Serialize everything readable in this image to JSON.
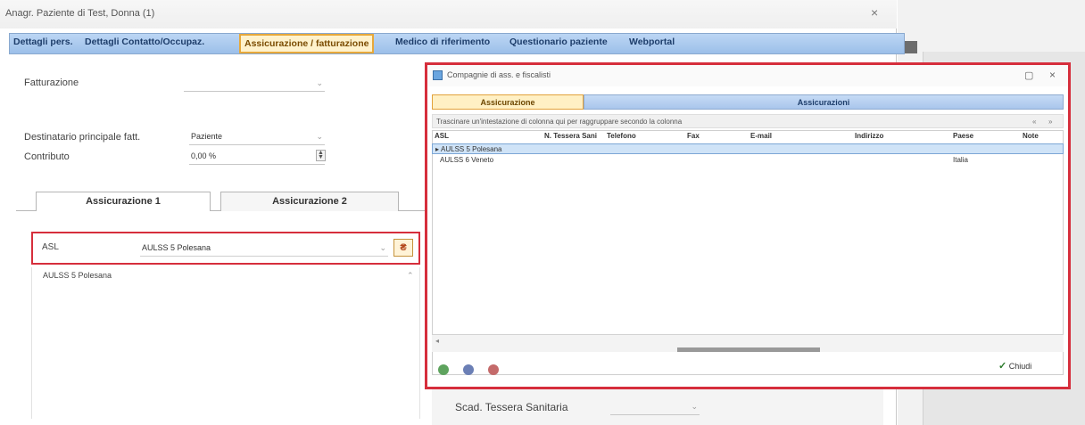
{
  "main_window": {
    "title": "Anagr. Paziente di Test, Donna (1)",
    "close": "×",
    "tabs": [
      "Dettagli pers.",
      "Dettagli Contatto/Occupaz.",
      "Assicurazione / fatturazione",
      "Medico di riferimento",
      "Questionario paziente",
      "Webportal"
    ],
    "active_tab_index": 2
  },
  "billing": {
    "fatturazione_label": "Fatturazione",
    "fatturazione_value": "",
    "destinatario_label": "Destinatario principale fatt.",
    "destinatario_value": "Paziente",
    "contributo_label": "Contributo",
    "contributo_value": "0,00 %"
  },
  "insurance_tabs": [
    "Assicurazione 1",
    "Assicurazione 2"
  ],
  "asl": {
    "label": "ASL",
    "value": "AULSS 5 Polesana",
    "list_item": "AULSS 5 Polesana",
    "button_icon": "asl-lookup-icon"
  },
  "lower": {
    "scad_label": "Scad. Tessera Sanitaria",
    "scad_value": ""
  },
  "dialog": {
    "title": "Compagnie di ass. e fiscalisti",
    "tabs": [
      "Assicurazione",
      "Assicurazioni"
    ],
    "hint": "Trascinare un'intestazione di colonna qui per raggruppare secondo la colonna",
    "columns": [
      "ASL",
      "N. Tessera Sani",
      "Telefono",
      "Fax",
      "E-mail",
      "Indirizzo",
      "Paese",
      "Note"
    ],
    "rows": [
      {
        "asl": "AULSS 5 Polesana",
        "paese": "",
        "selected": true
      },
      {
        "asl": "AULSS 6 Veneto",
        "paese": "Italia",
        "selected": false
      }
    ],
    "ok_label": "Chiudi",
    "footer_icons": [
      "add-icon",
      "edit-icon",
      "delete-icon"
    ]
  },
  "colors": {
    "highlight_red": "#d62e3c",
    "active_tab_bg": "#fff2cc",
    "tab_bar_blue": "#9cbfe9"
  }
}
